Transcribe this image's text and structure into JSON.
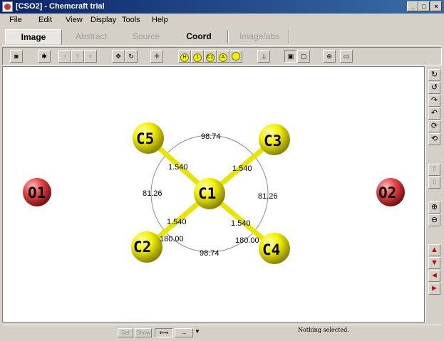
{
  "window": {
    "title": "[CSO2] - Chemcraft trial",
    "controls": [
      "_",
      "□",
      "×"
    ]
  },
  "menu": [
    "File",
    "Edit",
    "View",
    "Display",
    "Tools",
    "Help"
  ],
  "tabs": [
    {
      "label": "Image",
      "state": "active"
    },
    {
      "label": "Abstract",
      "state": "disabled"
    },
    {
      "label": "Source",
      "state": "disabled"
    },
    {
      "label": "Coord",
      "state": "normal"
    },
    {
      "label": "Image/abs",
      "state": "disabled"
    }
  ],
  "toolbar": {
    "label_buttons": [
      "H",
      "1",
      "C1",
      "A"
    ]
  },
  "molecule": {
    "atoms": [
      {
        "label": "O1",
        "element": "O",
        "color": "#e84848"
      },
      {
        "label": "O2",
        "element": "O",
        "color": "#e84848"
      },
      {
        "label": "C1",
        "element": "C",
        "color": "#f4f000"
      },
      {
        "label": "C2",
        "element": "C",
        "color": "#f4f000"
      },
      {
        "label": "C3",
        "element": "C",
        "color": "#f4f000"
      },
      {
        "label": "C4",
        "element": "C",
        "color": "#f4f000"
      },
      {
        "label": "C5",
        "element": "C",
        "color": "#f4f000"
      }
    ],
    "bond_lengths": [
      "1.540",
      "1.540",
      "1.540",
      "1.540"
    ],
    "angles": {
      "top": "98.74",
      "bottom": "98.74",
      "left": "81.26",
      "right": "81.26",
      "linear_left": "180.00",
      "linear_right": "180.00"
    }
  },
  "sidebar": {
    "rotate_icons": [
      "rotate-cw-icon",
      "rotate-ccw-icon",
      "rotate-right-icon",
      "rotate-left-icon",
      "rotate-up-icon",
      "rotate-down-icon"
    ],
    "zoom_icons": [
      "zoom-in-icon",
      "zoom-out-icon"
    ],
    "move_arrows": [
      "▲",
      "▼",
      "◄",
      "►"
    ]
  },
  "statusbar": {
    "set_label": "Set",
    "show_label": "Show",
    "message": "Nothing selected."
  },
  "colors": {
    "carbon": "#f4f000",
    "oxygen": "#e84848",
    "bond": "#e8e400",
    "accent": "#0a246a"
  }
}
